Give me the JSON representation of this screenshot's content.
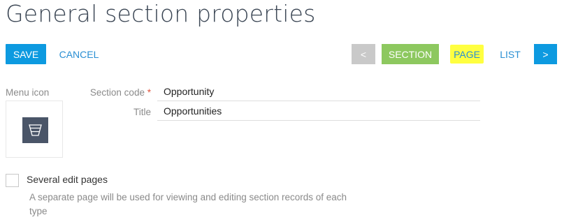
{
  "header": {
    "title": "General section properties"
  },
  "toolbar": {
    "save_label": "SAVE",
    "cancel_label": "CANCEL",
    "prev_label": "<",
    "section_label": "SECTION",
    "page_label": "PAGE",
    "list_label": "LIST",
    "next_label": ">"
  },
  "form": {
    "menu_icon_label": "Menu icon",
    "menu_icon": "funnel-icon",
    "section_code_label": "Section code",
    "required_marker": "*",
    "section_code_value": "Opportunity",
    "title_label": "Title",
    "title_value": "Opportunities",
    "several_edit_pages_label": "Several edit pages",
    "several_edit_pages_checked": false,
    "several_edit_pages_hint": "A separate page will be used for viewing and editing section records of each type"
  },
  "colors": {
    "primary": "#0d9ae0",
    "link": "#2a8fd3",
    "section_active": "#8dc85f",
    "disabled": "#c9c9c9",
    "highlight": "#ffff40",
    "required": "#e0543d",
    "icon_tile": "#4a5568"
  }
}
